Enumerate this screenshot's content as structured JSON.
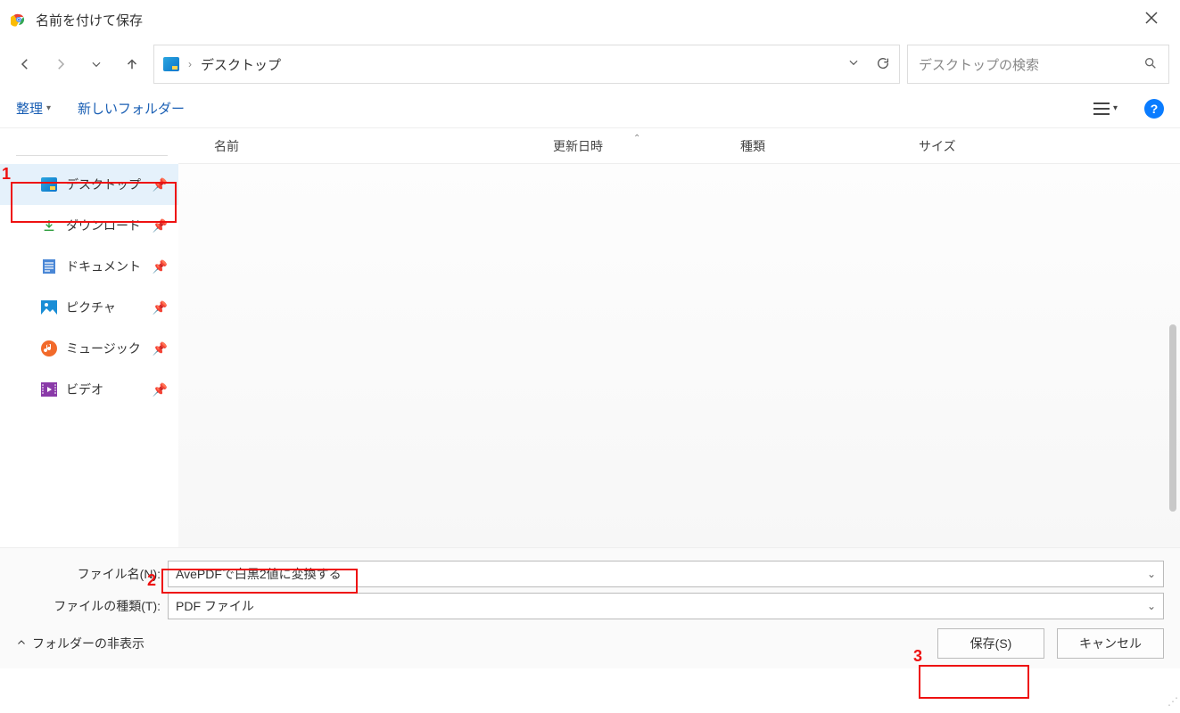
{
  "title": "名前を付けて保存",
  "breadcrumb": {
    "current": "デスクトップ"
  },
  "search": {
    "placeholder": "デスクトップの検索"
  },
  "toolbar": {
    "organize": "整理",
    "new_folder": "新しいフォルダー"
  },
  "sidebar": {
    "items": [
      {
        "label": "デスクトップ"
      },
      {
        "label": "ダウンロード"
      },
      {
        "label": "ドキュメント"
      },
      {
        "label": "ピクチャ"
      },
      {
        "label": "ミュージック"
      },
      {
        "label": "ビデオ"
      }
    ]
  },
  "columns": {
    "name": "名前",
    "date": "更新日時",
    "type": "種類",
    "size": "サイズ"
  },
  "fields": {
    "filename_label": "ファイル名(N):",
    "filename_value": "AvePDFで白黒2値に変換する",
    "filetype_label": "ファイルの種類(T):",
    "filetype_value": "PDF ファイル"
  },
  "footer": {
    "hide_folders": "フォルダーの非表示",
    "save": "保存(S)",
    "cancel": "キャンセル"
  },
  "annotations": {
    "a1": "1",
    "a2": "2",
    "a3": "3"
  }
}
